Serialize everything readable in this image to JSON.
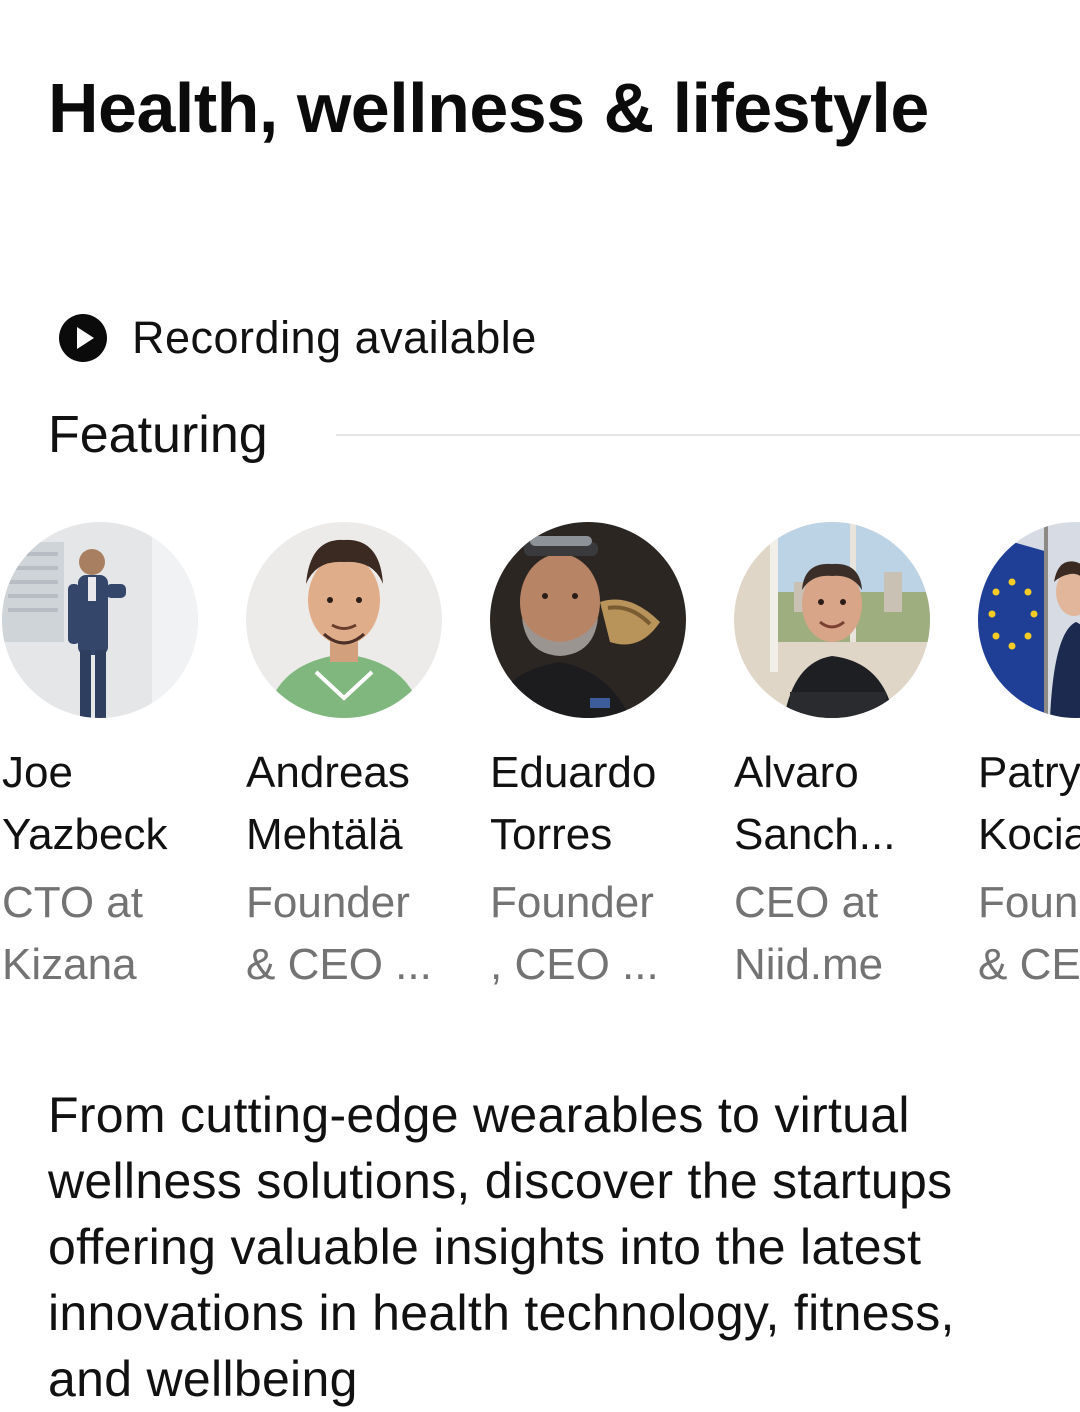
{
  "event": {
    "title": "Health, wellness & lifestyle",
    "recording_label": "Recording available",
    "featuring_label": "Featuring",
    "description": "From cutting-edge wearables to virtual wellness solutions, discover the startups offering valuable insights into the latest innovations in health technology, fitness, and wellbeing"
  },
  "speakers": [
    {
      "name_line1": "Joe",
      "name_line2": "Yazbeck",
      "role_line1": "CTO at",
      "role_line2": "Kizana"
    },
    {
      "name_line1": "Andreas",
      "name_line2": "Mehtälä",
      "role_line1": "Founder",
      "role_line2": "& CEO ..."
    },
    {
      "name_line1": "Eduardo",
      "name_line2": "Torres",
      "role_line1": "Founder",
      "role_line2": ", CEO ..."
    },
    {
      "name_line1": "Alvaro",
      "name_line2": "Sanch...",
      "role_line1": "CEO at",
      "role_line2": "Niid.me"
    },
    {
      "name_line1": "Patry",
      "name_line2": "Kocia",
      "role_line1": "Foun",
      "role_line2": "& CE"
    }
  ],
  "colors": {
    "text": "#111111",
    "muted_text": "#737373",
    "divider": "#e6e6e6",
    "background": "#ffffff"
  }
}
